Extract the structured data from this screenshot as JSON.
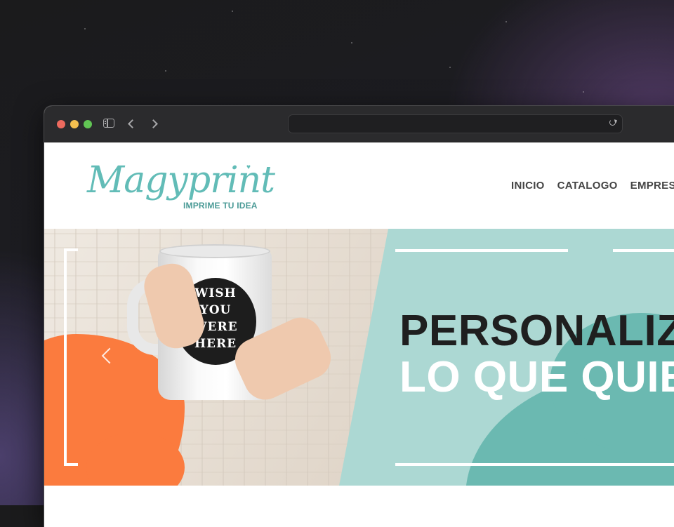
{
  "browser": {
    "url": ""
  },
  "site": {
    "logo_text": "Magyprint",
    "tagline": "IMPRIME TU IDEA",
    "nav": [
      "INICIO",
      "CATALOGO",
      "EMPRES"
    ]
  },
  "hero": {
    "headline_line1": "PERSONALIZ",
    "headline_line2": "LO QUE QUIEI",
    "mug_print_lines": [
      "WISH",
      "YOU",
      "WERE",
      "HERE"
    ]
  },
  "colors": {
    "brand_teal": "#62bcb7",
    "hero_teal_light": "#acd8d3",
    "hero_teal_dark": "#6bb9b1",
    "accent_orange": "#fb7b3e"
  }
}
